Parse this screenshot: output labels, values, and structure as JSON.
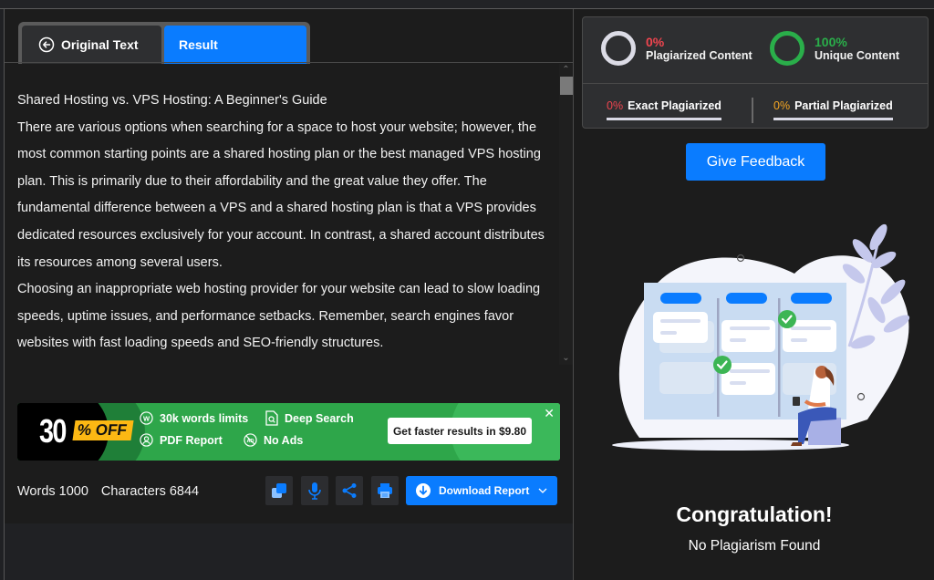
{
  "tabs": {
    "original": "Original Text",
    "result": "Result"
  },
  "content": {
    "paragraphs": [
      "Shared Hosting vs. VPS Hosting: A Beginner's Guide",
      "There are various options when searching for a space to host your website; however, the most common starting points are a shared hosting plan or the best managed VPS hosting plan. This is primarily due to their affordability and the great value they offer. The fundamental difference between a VPS and a shared hosting plan is that a VPS provides dedicated resources exclusively for your account. In contrast, a shared account distributes its resources among several users.",
      "Choosing an inappropriate web hosting provider for your website can lead to slow loading speeds, uptime issues, and performance setbacks. Remember, search engines favor websites with fast loading speeds and SEO-friendly structures."
    ]
  },
  "promo": {
    "discount_number": "30",
    "discount_suffix": "% OFF",
    "features": [
      "30k words limits",
      "Deep Search",
      "PDF Report",
      "No Ads"
    ],
    "cta": "Get faster results in $9.80",
    "close": "✕"
  },
  "stats": {
    "words_label": "Words 1000",
    "characters_label": "Characters 6844"
  },
  "actions": {
    "download_label": "Download Report"
  },
  "scores": {
    "plagiarized_pct": "0%",
    "plagiarized_label": "Plagiarized Content",
    "unique_pct": "100%",
    "unique_label": "Unique Content",
    "exact_pct": "0%",
    "exact_label": "Exact Plagiarized",
    "partial_pct": "0%",
    "partial_label": "Partial Plagiarized"
  },
  "feedback_label": "Give Feedback",
  "result": {
    "title": "Congratulation!",
    "subtitle": "No Plagiarism Found"
  },
  "colors": {
    "accent": "#0a7cff",
    "plagiarized": "#f0454f",
    "unique": "#2aae4a",
    "partial": "#f5a623"
  }
}
